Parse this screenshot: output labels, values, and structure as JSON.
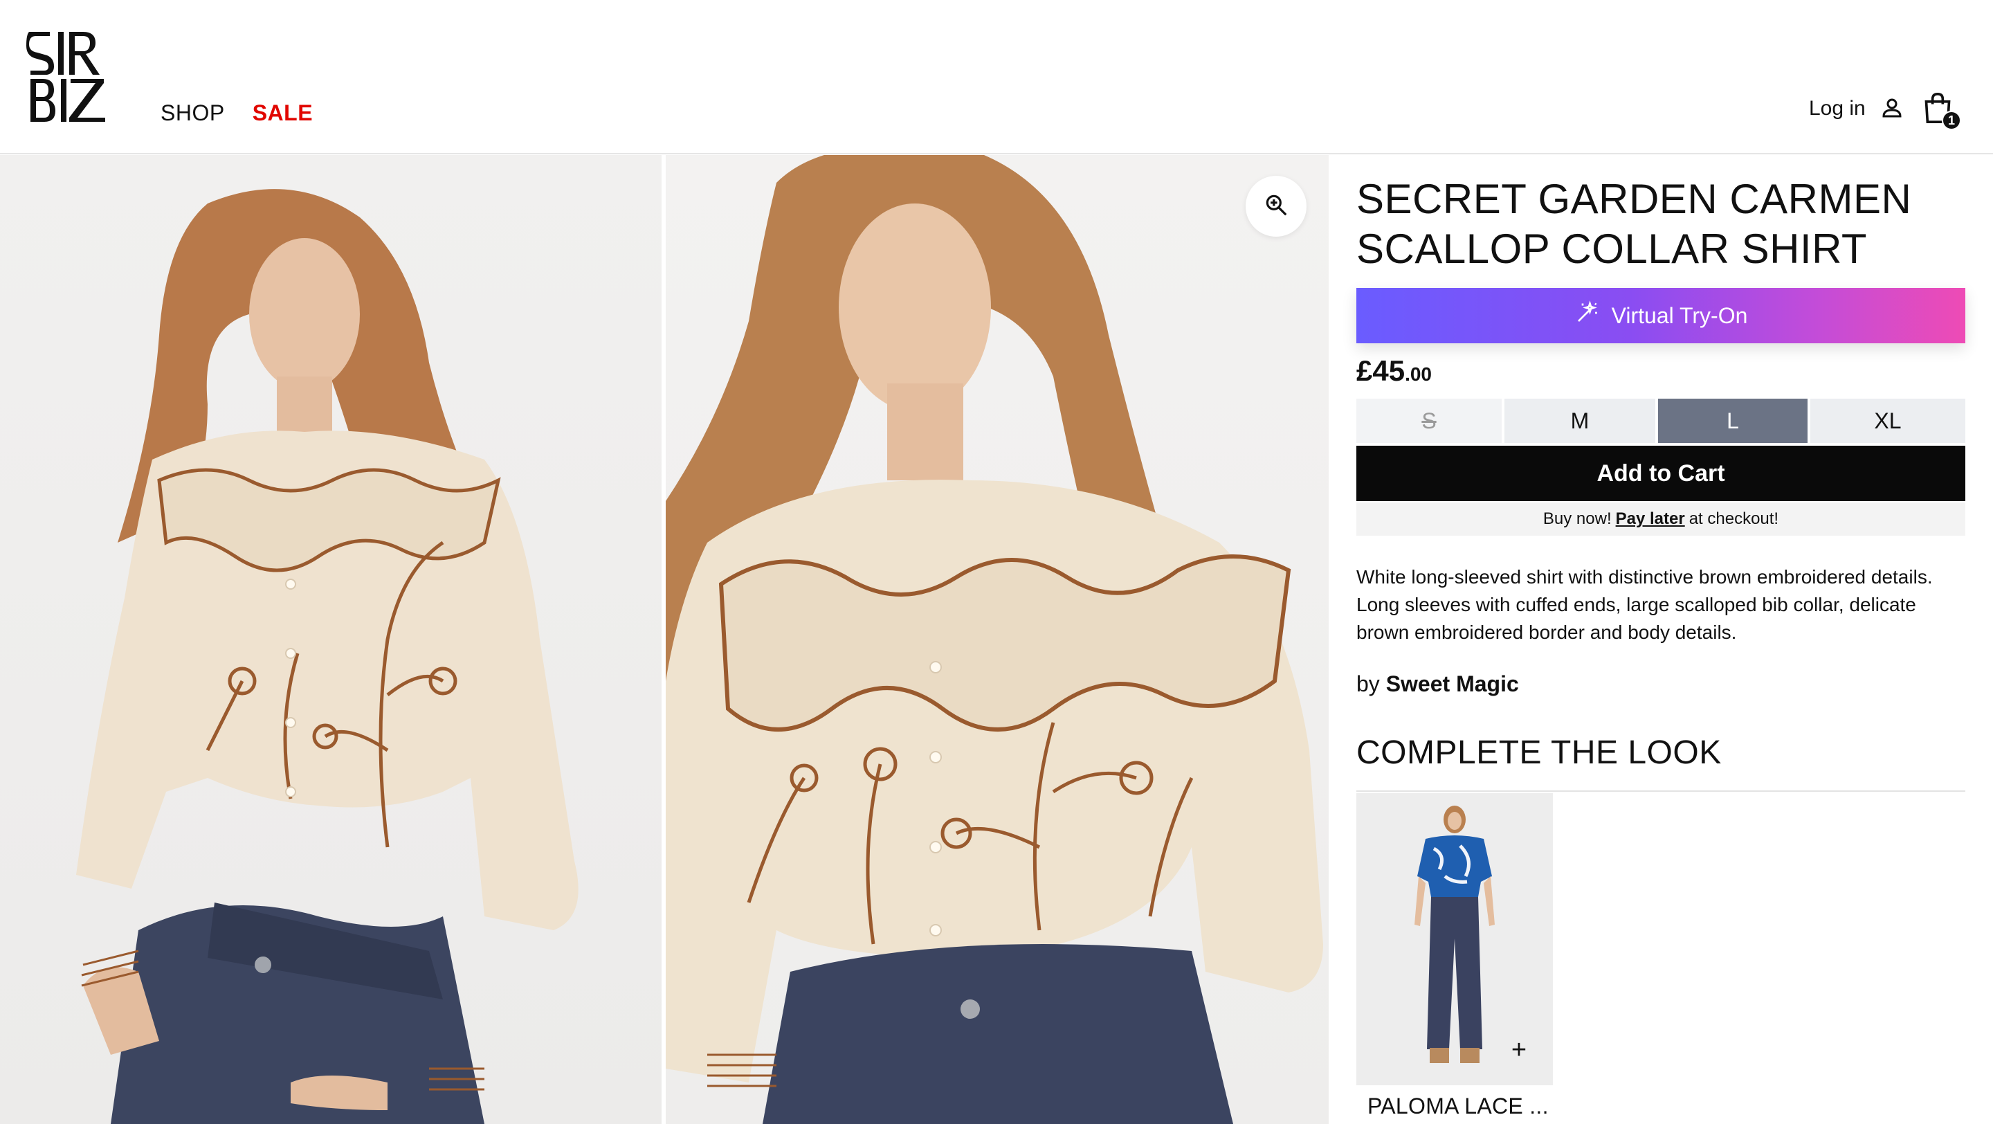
{
  "header": {
    "logo_text": "SIR BIZ",
    "nav": {
      "shop": "SHOP",
      "sale": "SALE"
    },
    "login": "Log in",
    "cart_count": "1"
  },
  "product": {
    "title": "SECRET GARDEN CARMEN SCALLOP COLLAR SHIRT",
    "tryon_label": "Virtual Try-On",
    "price_main": "£45",
    "price_pence": ".00",
    "sizes": [
      {
        "label": "S",
        "state": "unavailable"
      },
      {
        "label": "M",
        "state": "available"
      },
      {
        "label": "L",
        "state": "selected"
      },
      {
        "label": "XL",
        "state": "available"
      }
    ],
    "add_to_cart": "Add to Cart",
    "paylater": {
      "before": "Buy now!",
      "link": "Pay later",
      "after": "at checkout!"
    },
    "description": "White long-sleeved shirt with distinctive brown embroidered details. Long sleeves with cuffed ends, large scalloped bib collar, delicate brown embroidered border and body details.",
    "by_prefix": "by",
    "brand": "Sweet Magic"
  },
  "complete_the_look": {
    "heading": "COMPLETE THE LOOK",
    "items": [
      {
        "name": "PALOMA LACE ..."
      }
    ]
  },
  "colors": {
    "sale": "#e10600",
    "tryon_start": "#6a5cff",
    "tryon_end": "#ee4bb5",
    "size_selected": "#6b7385",
    "cart_button": "#0a0a0a"
  },
  "icons": [
    "user-icon",
    "shopping-bag-icon",
    "zoom-in-icon",
    "magic-wand-icon",
    "plus-icon"
  ]
}
